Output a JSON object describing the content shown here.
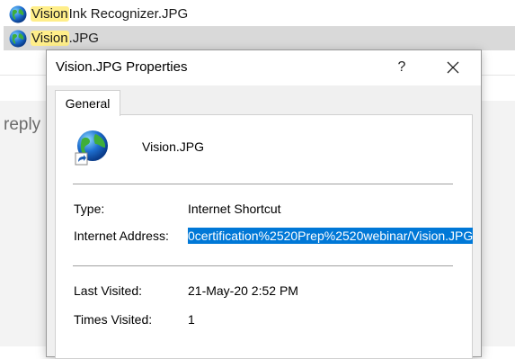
{
  "results": [
    {
      "highlight": "Vision",
      "rest": " Ink Recognizer.JPG"
    },
    {
      "highlight": "Vision",
      "rest": ".JPG"
    }
  ],
  "background": {
    "reply_label": "reply"
  },
  "dialog": {
    "title": "Vision.JPG Properties",
    "help_label": "?",
    "tab_label": "General",
    "file_name": "Vision.JPG",
    "fields": {
      "type_label": "Type:",
      "type_value": "Internet Shortcut",
      "address_label": "Internet Address:",
      "address_value": "0certification%2520Prep%2520webinar/Vision.JPG",
      "last_visited_label": "Last Visited:",
      "last_visited_value": "21-May-20 2:52 PM",
      "times_visited_label": "Times Visited:",
      "times_visited_value": "1"
    }
  },
  "colors": {
    "selection": "#0078d7",
    "search_highlight": "#ffee8a",
    "selected_row": "#d9d9d9"
  },
  "icons": [
    "globe-icon",
    "shortcut-arrow-icon",
    "close-icon"
  ]
}
